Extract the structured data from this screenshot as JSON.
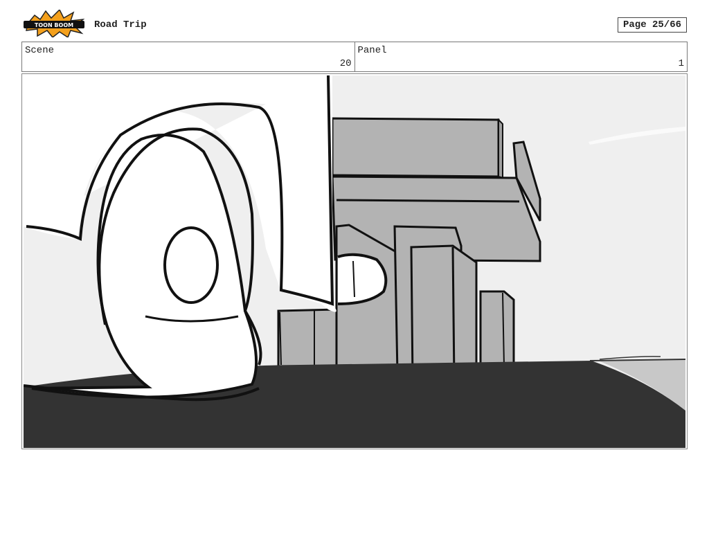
{
  "header": {
    "logo_text": "TOON BOOM",
    "title": "Road Trip",
    "page_label": "Page 25/66"
  },
  "info": {
    "scene_label": "Scene",
    "scene_value": "20",
    "panel_label": "Panel",
    "panel_value": "1"
  },
  "colors": {
    "sky": "#efefef",
    "road": "#333333",
    "building": "#b3b3b3",
    "outline": "#111111"
  }
}
